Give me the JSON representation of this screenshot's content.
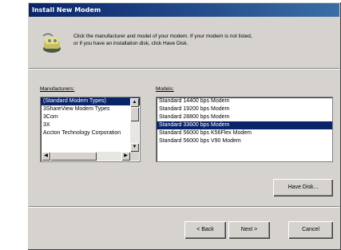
{
  "window": {
    "title": "Install New Modem"
  },
  "instructions": {
    "line1": "Click the manufacturer and model of your modem. If your modem is not listed,",
    "line2": "or if you have an installation disk, click Have Disk."
  },
  "manufacturers": {
    "label": "Manufacturers:",
    "items": [
      {
        "label": "(Standard Modem Types)",
        "selected": true
      },
      {
        "label": "3ShareView Modem Types",
        "selected": false
      },
      {
        "label": "3Com",
        "selected": false
      },
      {
        "label": "3X",
        "selected": false
      },
      {
        "label": "Accton Technology Corporation",
        "selected": false
      }
    ]
  },
  "models": {
    "label": "Models:",
    "items": [
      {
        "label": "Standard 14400 bps Modem",
        "selected": false
      },
      {
        "label": "Standard 19200 bps Modem",
        "selected": false
      },
      {
        "label": "Standard 28800 bps Modem",
        "selected": false
      },
      {
        "label": "Standard 33600 bps Modem",
        "selected": true
      },
      {
        "label": "Standard 56000 bps K56Flex Modem",
        "selected": false
      },
      {
        "label": "Standard 56000 bps V90 Modem",
        "selected": false
      }
    ]
  },
  "buttons": {
    "have_disk": "Have Disk...",
    "back": "< Back",
    "next": "Next >",
    "cancel": "Cancel"
  },
  "icons": {
    "header": "modem-install-icon",
    "scroll_up": "scroll-up-arrow-icon",
    "scroll_down": "scroll-down-arrow-icon",
    "scroll_left": "scroll-left-arrow-icon",
    "scroll_right": "scroll-right-arrow-icon"
  }
}
